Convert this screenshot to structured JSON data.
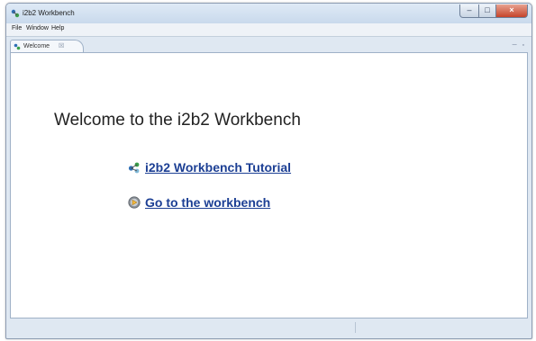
{
  "window": {
    "title": "i2b2 Workbench",
    "controls": {
      "minimize": "–",
      "maximize": "□",
      "close": "×"
    }
  },
  "menubar": {
    "items": [
      "File",
      "Window",
      "Help"
    ]
  },
  "editor": {
    "tab_label": "Welcome",
    "tab_close": "☒",
    "view_controls": "─ ▫"
  },
  "welcome": {
    "heading": "Welcome to the i2b2 Workbench",
    "links": [
      {
        "label": "i2b2 Workbench Tutorial",
        "icon": "tutorial-icon"
      },
      {
        "label": "Go to the workbench",
        "icon": "workbench-icon"
      }
    ]
  },
  "colors": {
    "link": "#1c3f94",
    "titlebar": "#c9d9ec",
    "close": "#c5432a",
    "window_frame": "#dfe8f2"
  }
}
